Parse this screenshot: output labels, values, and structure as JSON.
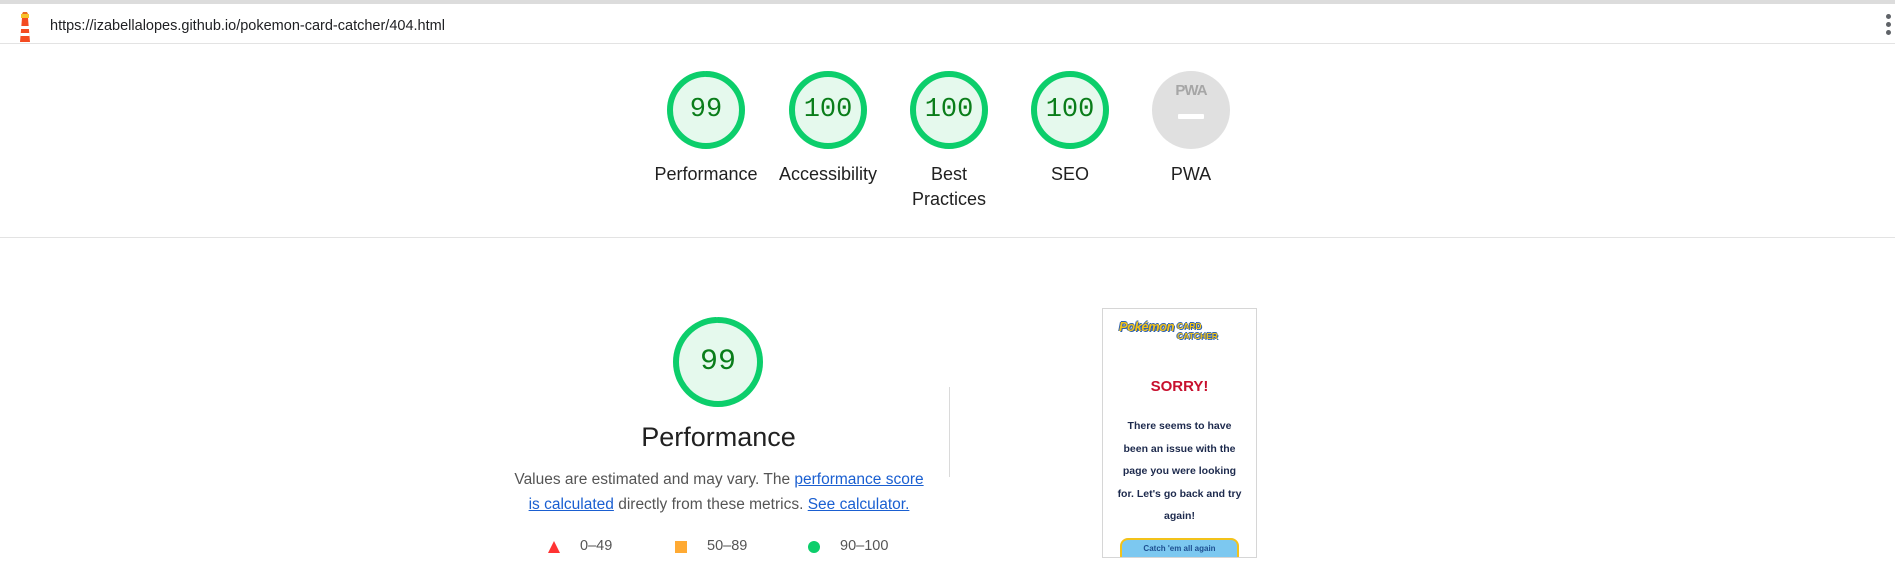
{
  "browser": {
    "url": "https://izabellalopes.github.io/pokemon-card-catcher/404.html",
    "logo_icon": "lighthouse-icon",
    "menu_icon": "vertical-dots-icon"
  },
  "categories": [
    {
      "label": "Performance",
      "score": "99",
      "fraction": 0.99
    },
    {
      "label": "Accessibility",
      "score": "100",
      "fraction": 1.0
    },
    {
      "label": "Best Practices",
      "score": "100",
      "fraction": 1.0
    },
    {
      "label": "SEO",
      "score": "100",
      "fraction": 1.0
    },
    {
      "label": "PWA",
      "score": "",
      "badge": "PWA"
    }
  ],
  "performance": {
    "score": "99",
    "fraction": 0.99,
    "title": "Performance",
    "desc_before": "Values are estimated and may vary. The ",
    "link_score": "performance score is calculated",
    "desc_middle": " directly from these metrics. ",
    "link_calc": "See calculator."
  },
  "legend": [
    {
      "range": "0–49",
      "shape": "triangle",
      "color": "#ff3333"
    },
    {
      "range": "50–89",
      "shape": "square",
      "color": "#ffaa33"
    },
    {
      "range": "90–100",
      "shape": "circle",
      "color": "#0cce6b"
    }
  ],
  "screenshot": {
    "logo_main": "Pokémon",
    "logo_sub": "CARD CATCHER",
    "heading": "SORRY!",
    "message": "There seems to have been an issue with the page you were looking for. Let's go back and try again!",
    "button": "Catch 'em all again"
  },
  "colors": {
    "pass_green": "#0cce6b",
    "pass_fill": "#e5f9ed",
    "score_text": "#0a7d1a",
    "na_gray": "#e0e0e0"
  }
}
